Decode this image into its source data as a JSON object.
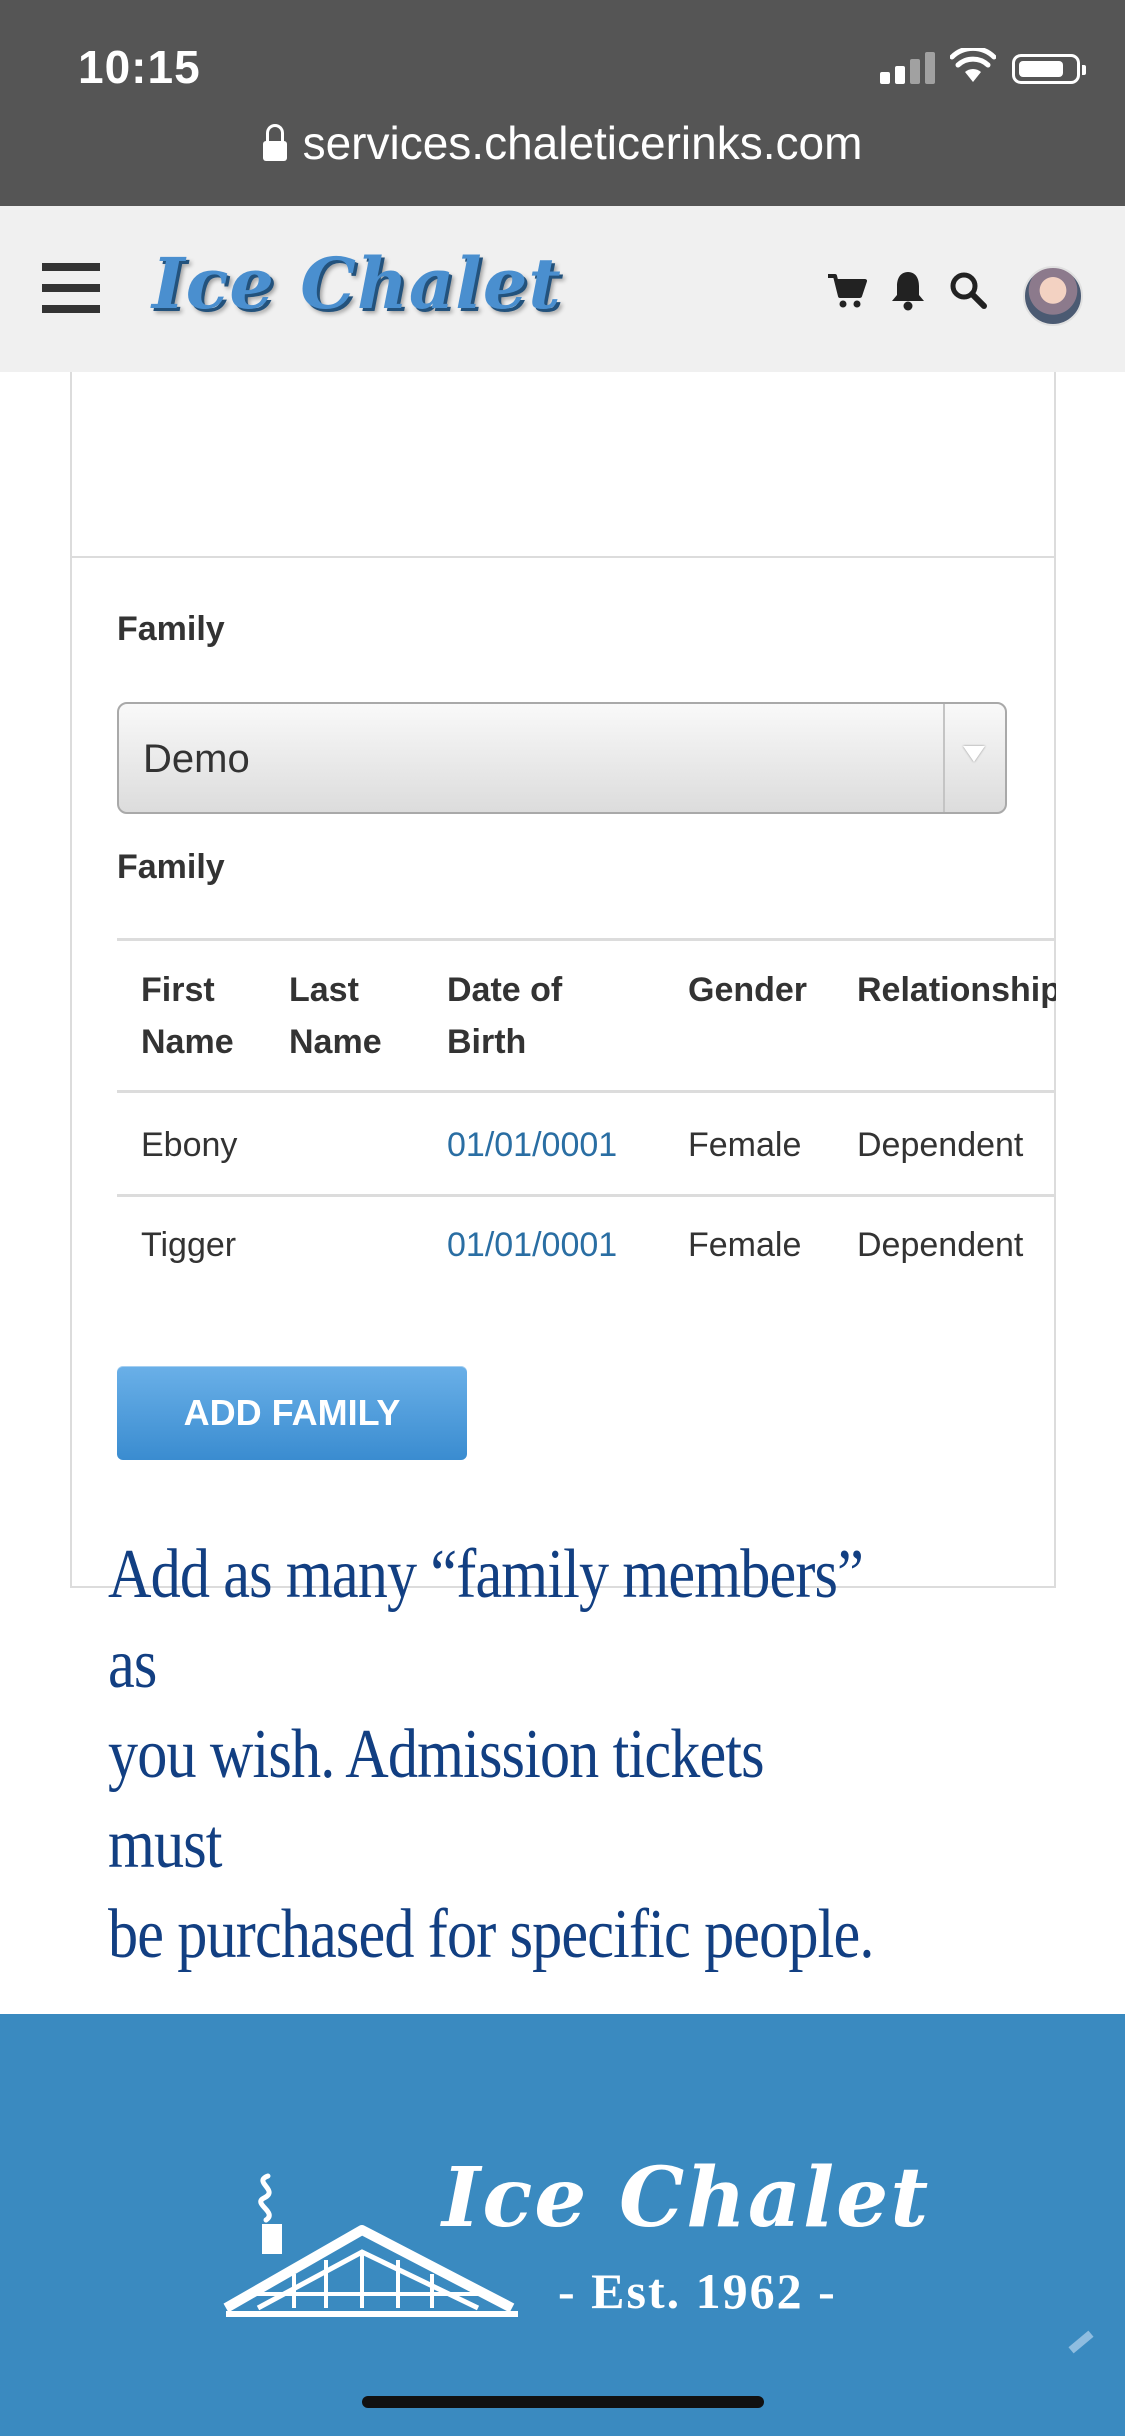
{
  "status_bar": {
    "time": "10:15"
  },
  "browser": {
    "url": "services.chaleticerinks.com"
  },
  "header": {
    "logo_text": "Ice Chalet",
    "icons": [
      "menu-icon",
      "cart-icon",
      "bell-icon",
      "search-icon",
      "avatar"
    ]
  },
  "family_section": {
    "select_label": "Family",
    "selected_family": "Demo",
    "table_label": "Family",
    "columns": [
      "First Name",
      "Last Name",
      "Date of Birth",
      "Gender",
      "Relationship"
    ],
    "rows": [
      {
        "first_name": "Ebony",
        "last_name": "",
        "dob": "01/01/0001",
        "gender": "Female",
        "relationship": "Dependent"
      },
      {
        "first_name": "Tigger",
        "last_name": "",
        "dob": "01/01/0001",
        "gender": "Female",
        "relationship": "Dependent"
      }
    ],
    "add_button": "ADD FAMILY"
  },
  "annotation": {
    "lines": [
      "Add as many “family members” as",
      "you wish.  Admission tickets must",
      "be purchased for specific people."
    ]
  },
  "footer": {
    "logo_title": "Ice Chalet",
    "established": "- Est. 1962 -"
  },
  "colors": {
    "accent": "#3a8ac0",
    "link": "#2a6ea3",
    "annotation": "#123f82"
  }
}
